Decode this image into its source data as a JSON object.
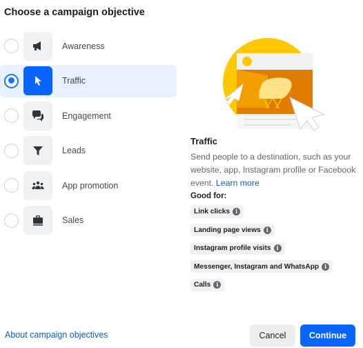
{
  "header": {
    "title": "Choose a campaign objective"
  },
  "objectives": [
    {
      "label": "Awareness",
      "icon": "megaphone-icon",
      "selected": false
    },
    {
      "label": "Traffic",
      "icon": "cursor-icon",
      "selected": true
    },
    {
      "label": "Engagement",
      "icon": "chat-bubbles-icon",
      "selected": false
    },
    {
      "label": "Leads",
      "icon": "filter-icon",
      "selected": false
    },
    {
      "label": "App promotion",
      "icon": "people-icon",
      "selected": false
    },
    {
      "label": "Sales",
      "icon": "briefcase-icon",
      "selected": false
    }
  ],
  "detail": {
    "title": "Traffic",
    "description": "Send people to a destination, such as your website, app, Instagram profile or Facebook event.",
    "learn_more": "Learn more",
    "good_for_label": "Good for:",
    "good_for": [
      "Link clicks",
      "Landing page views",
      "Instagram profile visits",
      "Messenger, Instagram and WhatsApp",
      "Calls"
    ],
    "info_icon": "info-icon"
  },
  "footer": {
    "about_link": "About campaign objectives",
    "cancel_label": "Cancel",
    "continue_label": "Continue"
  },
  "colors": {
    "accent": "#0866ff",
    "selected_bg": "#e7f0fd",
    "link": "#0a5dc2",
    "illustration_yellow": "#ffc800"
  }
}
